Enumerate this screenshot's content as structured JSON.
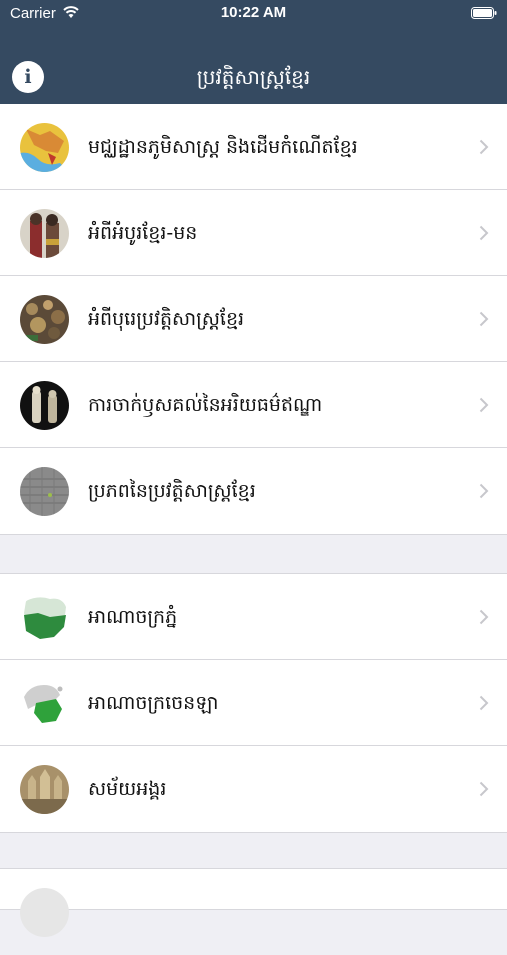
{
  "status_bar": {
    "carrier": "Carrier",
    "time": "10:22 AM"
  },
  "nav": {
    "title": "ប្រវត្តិសាស្ត្រខ្មែរ",
    "info_label": "i"
  },
  "colors": {
    "header_bg": "#354a61",
    "separator_bg": "#efeff4"
  },
  "sections": [
    {
      "items": [
        {
          "label": "មជ្ឈដ្ឋានភូមិសាស្ត្រ និងដើមកំណើតខ្មែរ",
          "icon": "map-thumbnail-icon"
        },
        {
          "label": "អំពីអំបូរខ្មែរ-មន",
          "icon": "people-thumbnail-icon"
        },
        {
          "label": "អំពីបុរេប្រវត្តិសាស្ត្រខ្មែរ",
          "icon": "artifacts-thumbnail-icon"
        },
        {
          "label": "ការចាក់ឫសគល់នៃអរិយធម៌ឥណ្ឌា",
          "icon": "statues-thumbnail-icon"
        },
        {
          "label": "ប្រភពនៃប្រវត្តិសាស្ត្រខ្មែរ",
          "icon": "stone-thumbnail-icon"
        }
      ]
    },
    {
      "items": [
        {
          "label": "អាណាចក្រភ្នំ",
          "icon": "funan-map-icon"
        },
        {
          "label": "អាណាចក្រចេនឡា",
          "icon": "chenla-map-icon"
        },
        {
          "label": "សម័យអង្គរ",
          "icon": "angkor-thumbnail-icon"
        }
      ]
    }
  ]
}
